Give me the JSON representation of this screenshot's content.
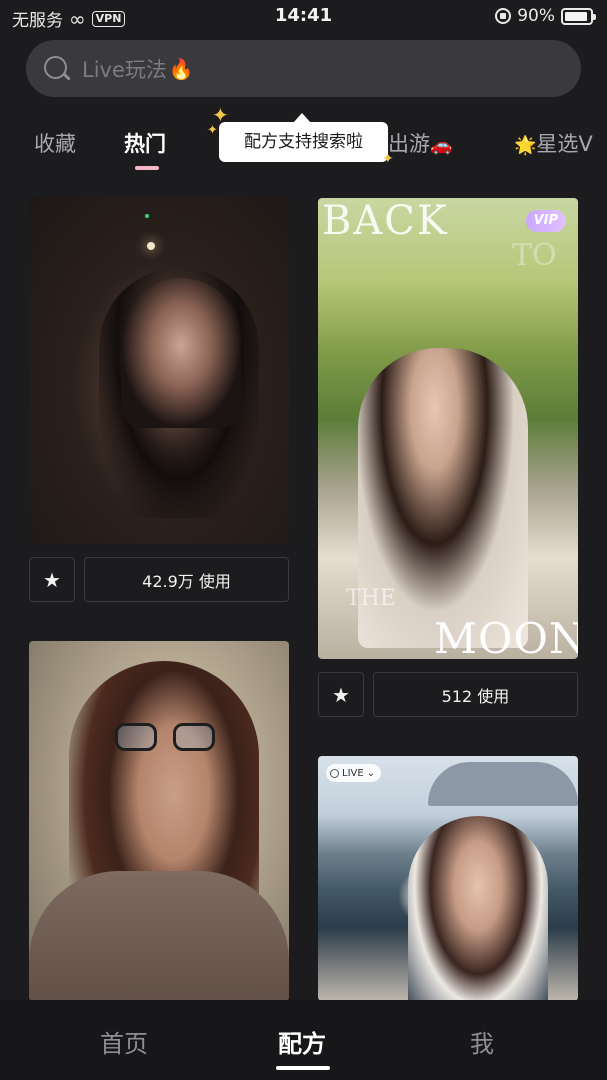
{
  "status_bar": {
    "carrier": "无服务",
    "vpn": "VPN",
    "time": "14:41",
    "battery": "90%",
    "battery_level": 0.9
  },
  "search": {
    "placeholder": "Live玩法",
    "flame_icon": "fire-emoji"
  },
  "tabs": [
    {
      "label": "收藏",
      "active": false
    },
    {
      "label": "热门",
      "active": true
    },
    {
      "label": "出游",
      "emoji": "🚗",
      "active": false
    },
    {
      "label": "星选V",
      "emoji": "🌟",
      "active": false
    }
  ],
  "tooltip": {
    "text": "配方支持搜索啦"
  },
  "feed": [
    {
      "id": "card-1",
      "uses": "42.9万 使用"
    },
    {
      "id": "card-2",
      "uses": "512 使用",
      "badge": "VIP",
      "overlay_top": "BACK",
      "overlay_mid": "TO",
      "overlay_the": "THE",
      "overlay_bottom": "MOON"
    },
    {
      "id": "card-3"
    },
    {
      "id": "card-4",
      "badge": "LIVE"
    }
  ],
  "bottom_nav": [
    {
      "label": "首页",
      "active": false
    },
    {
      "label": "配方",
      "active": true
    },
    {
      "label": "我",
      "active": false
    }
  ],
  "colors": {
    "background": "#1c1c1e",
    "search_bg": "#3a3a3c",
    "tab_underline": "#f7b7c4",
    "vip_badge": "#c9a7ff"
  }
}
